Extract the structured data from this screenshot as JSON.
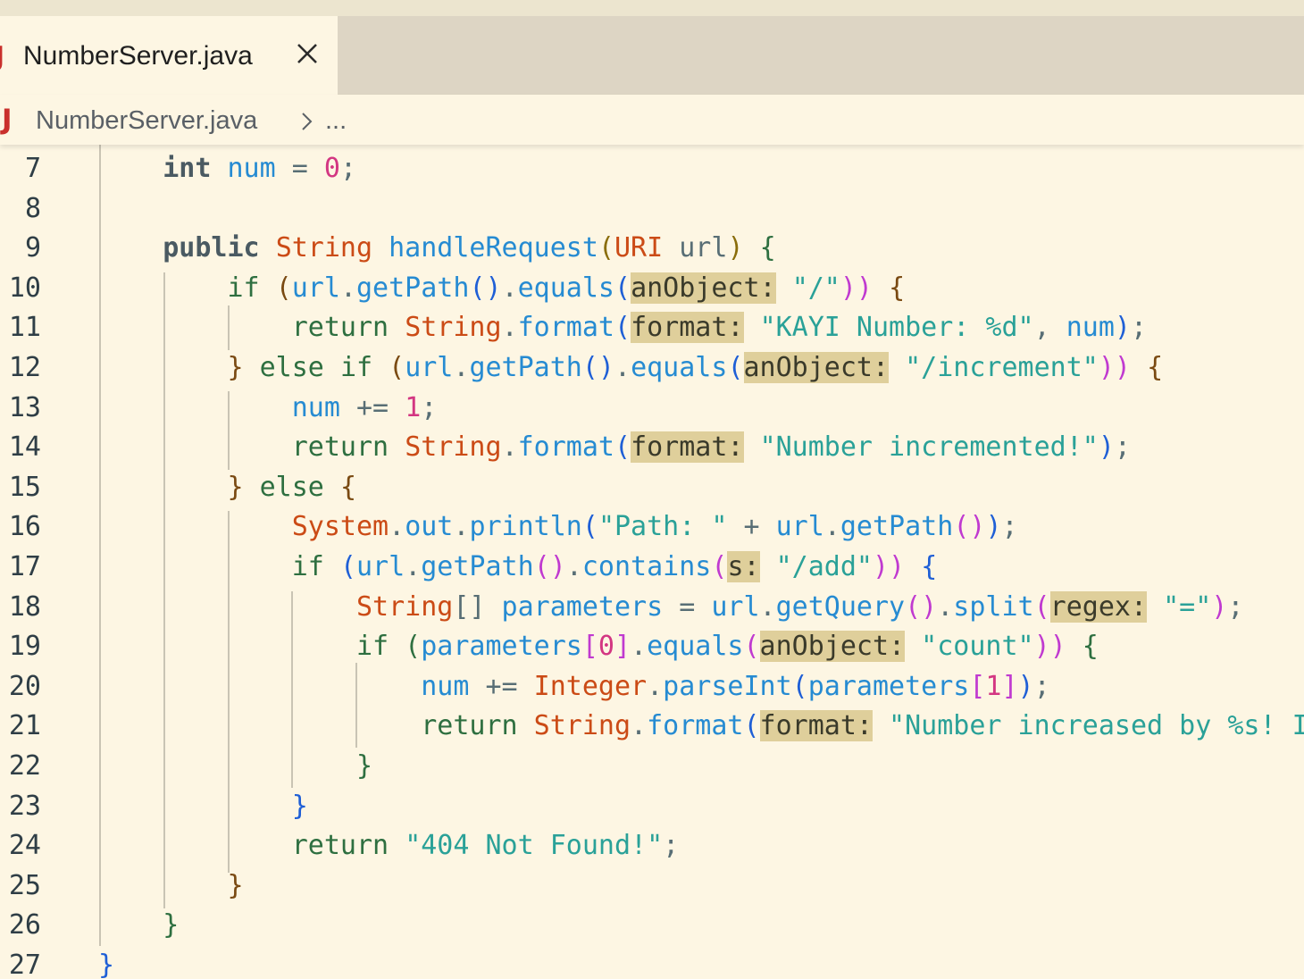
{
  "tab": {
    "icon_letter": "J",
    "label": "NumberServer.java",
    "close_glyph": "×"
  },
  "breadcrumb": {
    "icon_letter": "J",
    "file": "NumberServer.java",
    "rest": "..."
  },
  "theme": {
    "background": "#fdf6e3",
    "tabbar": "#ddd5c4",
    "keyword": "#2e6f40",
    "type": "#cb4b16",
    "identifier": "#268bd2",
    "string": "#2aa198",
    "number": "#d33682",
    "inlay_hint_bg": "#dfcf9b",
    "java_icon": "#c9302c"
  },
  "lines": [
    {
      "n": "7",
      "tokens": [
        [
          "    ",
          ""
        ],
        [
          "int",
          "t-kw-bold"
        ],
        [
          " ",
          ""
        ],
        [
          "num",
          "t-var"
        ],
        [
          " = ",
          "t-op"
        ],
        [
          "0",
          "t-num"
        ],
        [
          ";",
          "t-op"
        ]
      ]
    },
    {
      "n": "8",
      "tokens": []
    },
    {
      "n": "9",
      "tokens": [
        [
          "    ",
          ""
        ],
        [
          "public",
          "t-kw-bold"
        ],
        [
          " ",
          ""
        ],
        [
          "String",
          "t-type"
        ],
        [
          " ",
          ""
        ],
        [
          "handleRequest",
          "t-fn"
        ],
        [
          "(",
          "t-gold"
        ],
        [
          "URI",
          "t-type"
        ],
        [
          " url",
          "t-op"
        ],
        [
          ")",
          "t-gold"
        ],
        [
          " ",
          ""
        ],
        [
          "{",
          "t-kw"
        ]
      ]
    },
    {
      "n": "10",
      "tokens": [
        [
          "        ",
          ""
        ],
        [
          "if",
          "t-kw"
        ],
        [
          " ",
          ""
        ],
        [
          "(",
          "t-brn"
        ],
        [
          "url",
          "t-var"
        ],
        [
          ".",
          "t-op"
        ],
        [
          "getPath",
          "t-fn"
        ],
        [
          "()",
          "t-br3"
        ],
        [
          ".",
          "t-op"
        ],
        [
          "equals",
          "t-fn"
        ],
        [
          "(",
          "t-br3"
        ],
        [
          "anObject:",
          "t-hint"
        ],
        [
          " ",
          ""
        ],
        [
          "\"/\"",
          "t-str"
        ],
        [
          "))",
          "t-br2"
        ],
        [
          " ",
          ""
        ],
        [
          "{",
          "t-brn"
        ]
      ]
    },
    {
      "n": "11",
      "tokens": [
        [
          "            ",
          ""
        ],
        [
          "return",
          "t-kw"
        ],
        [
          " ",
          ""
        ],
        [
          "String",
          "t-type"
        ],
        [
          ".",
          "t-op"
        ],
        [
          "format",
          "t-fn"
        ],
        [
          "(",
          "t-br3"
        ],
        [
          "format:",
          "t-hint"
        ],
        [
          " ",
          ""
        ],
        [
          "\"KAYI Number: %d\"",
          "t-str"
        ],
        [
          ", ",
          "t-op"
        ],
        [
          "num",
          "t-var"
        ],
        [
          ")",
          "t-br3"
        ],
        [
          ";",
          "t-op"
        ]
      ]
    },
    {
      "n": "12",
      "tokens": [
        [
          "        ",
          ""
        ],
        [
          "}",
          "t-brn"
        ],
        [
          " ",
          ""
        ],
        [
          "else",
          "t-kw"
        ],
        [
          " ",
          ""
        ],
        [
          "if",
          "t-kw"
        ],
        [
          " ",
          ""
        ],
        [
          "(",
          "t-brn"
        ],
        [
          "url",
          "t-var"
        ],
        [
          ".",
          "t-op"
        ],
        [
          "getPath",
          "t-fn"
        ],
        [
          "()",
          "t-br3"
        ],
        [
          ".",
          "t-op"
        ],
        [
          "equals",
          "t-fn"
        ],
        [
          "(",
          "t-br3"
        ],
        [
          "anObject:",
          "t-hint"
        ],
        [
          " ",
          ""
        ],
        [
          "\"/increment\"",
          "t-str"
        ],
        [
          "))",
          "t-br2"
        ],
        [
          " ",
          ""
        ],
        [
          "{",
          "t-brn"
        ]
      ]
    },
    {
      "n": "13",
      "tokens": [
        [
          "            ",
          ""
        ],
        [
          "num",
          "t-var"
        ],
        [
          " += ",
          "t-op"
        ],
        [
          "1",
          "t-num"
        ],
        [
          ";",
          "t-op"
        ]
      ]
    },
    {
      "n": "14",
      "tokens": [
        [
          "            ",
          ""
        ],
        [
          "return",
          "t-kw"
        ],
        [
          " ",
          ""
        ],
        [
          "String",
          "t-type"
        ],
        [
          ".",
          "t-op"
        ],
        [
          "format",
          "t-fn"
        ],
        [
          "(",
          "t-br3"
        ],
        [
          "format:",
          "t-hint"
        ],
        [
          " ",
          ""
        ],
        [
          "\"Number incremented!\"",
          "t-str"
        ],
        [
          ")",
          "t-br3"
        ],
        [
          ";",
          "t-op"
        ]
      ]
    },
    {
      "n": "15",
      "tokens": [
        [
          "        ",
          ""
        ],
        [
          "}",
          "t-brn"
        ],
        [
          " ",
          ""
        ],
        [
          "else",
          "t-kw"
        ],
        [
          " ",
          ""
        ],
        [
          "{",
          "t-brn"
        ]
      ]
    },
    {
      "n": "16",
      "tokens": [
        [
          "            ",
          ""
        ],
        [
          "System",
          "t-type"
        ],
        [
          ".",
          "t-op"
        ],
        [
          "out",
          "t-var"
        ],
        [
          ".",
          "t-op"
        ],
        [
          "println",
          "t-fn"
        ],
        [
          "(",
          "t-br3"
        ],
        [
          "\"Path: \"",
          "t-str"
        ],
        [
          " + ",
          "t-op"
        ],
        [
          "url",
          "t-var"
        ],
        [
          ".",
          "t-op"
        ],
        [
          "getPath",
          "t-fn"
        ],
        [
          "()",
          "t-br2"
        ],
        [
          ")",
          "t-br3"
        ],
        [
          ";",
          "t-op"
        ]
      ]
    },
    {
      "n": "17",
      "tokens": [
        [
          "            ",
          ""
        ],
        [
          "if",
          "t-kw"
        ],
        [
          " ",
          ""
        ],
        [
          "(",
          "t-br3"
        ],
        [
          "url",
          "t-var"
        ],
        [
          ".",
          "t-op"
        ],
        [
          "getPath",
          "t-fn"
        ],
        [
          "()",
          "t-br2"
        ],
        [
          ".",
          "t-op"
        ],
        [
          "contains",
          "t-fn"
        ],
        [
          "(",
          "t-br2"
        ],
        [
          "s:",
          "t-hint"
        ],
        [
          " ",
          ""
        ],
        [
          "\"/add\"",
          "t-str"
        ],
        [
          "))",
          "t-br2"
        ],
        [
          " ",
          ""
        ],
        [
          "{",
          "t-br3"
        ]
      ]
    },
    {
      "n": "18",
      "tokens": [
        [
          "                ",
          ""
        ],
        [
          "String",
          "t-type"
        ],
        [
          "[]",
          "t-op"
        ],
        [
          " ",
          ""
        ],
        [
          "parameters",
          "t-var"
        ],
        [
          " = ",
          "t-op"
        ],
        [
          "url",
          "t-var"
        ],
        [
          ".",
          "t-op"
        ],
        [
          "getQuery",
          "t-fn"
        ],
        [
          "()",
          "t-br2"
        ],
        [
          ".",
          "t-op"
        ],
        [
          "split",
          "t-fn"
        ],
        [
          "(",
          "t-br2"
        ],
        [
          "regex:",
          "t-hint"
        ],
        [
          " ",
          ""
        ],
        [
          "\"=\"",
          "t-str"
        ],
        [
          ")",
          "t-br2"
        ],
        [
          ";",
          "t-op"
        ]
      ]
    },
    {
      "n": "19",
      "tokens": [
        [
          "                ",
          ""
        ],
        [
          "if",
          "t-kw"
        ],
        [
          " ",
          ""
        ],
        [
          "(",
          "t-kw"
        ],
        [
          "parameters",
          "t-var"
        ],
        [
          "[",
          "t-br2"
        ],
        [
          "0",
          "t-num"
        ],
        [
          "]",
          "t-br2"
        ],
        [
          ".",
          "t-op"
        ],
        [
          "equals",
          "t-fn"
        ],
        [
          "(",
          "t-br2"
        ],
        [
          "anObject:",
          "t-hint"
        ],
        [
          " ",
          ""
        ],
        [
          "\"count\"",
          "t-str"
        ],
        [
          "))",
          "t-br2"
        ],
        [
          " ",
          ""
        ],
        [
          "{",
          "t-kw"
        ]
      ]
    },
    {
      "n": "20",
      "tokens": [
        [
          "                    ",
          ""
        ],
        [
          "num",
          "t-var"
        ],
        [
          " += ",
          "t-op"
        ],
        [
          "Integer",
          "t-type"
        ],
        [
          ".",
          "t-op"
        ],
        [
          "parseInt",
          "t-fn"
        ],
        [
          "(",
          "t-br3"
        ],
        [
          "parameters",
          "t-var"
        ],
        [
          "[",
          "t-br2"
        ],
        [
          "1",
          "t-num"
        ],
        [
          "]",
          "t-br2"
        ],
        [
          ")",
          "t-br3"
        ],
        [
          ";",
          "t-op"
        ]
      ]
    },
    {
      "n": "21",
      "tokens": [
        [
          "                    ",
          ""
        ],
        [
          "return",
          "t-kw"
        ],
        [
          " ",
          ""
        ],
        [
          "String",
          "t-type"
        ],
        [
          ".",
          "t-op"
        ],
        [
          "format",
          "t-fn"
        ],
        [
          "(",
          "t-br3"
        ],
        [
          "format:",
          "t-hint"
        ],
        [
          " ",
          ""
        ],
        [
          "\"Number increased by %s! It",
          "t-str"
        ]
      ]
    },
    {
      "n": "22",
      "tokens": [
        [
          "                ",
          ""
        ],
        [
          "}",
          "t-kw"
        ]
      ]
    },
    {
      "n": "23",
      "tokens": [
        [
          "            ",
          ""
        ],
        [
          "}",
          "t-br3"
        ]
      ]
    },
    {
      "n": "24",
      "tokens": [
        [
          "            ",
          ""
        ],
        [
          "return",
          "t-kw"
        ],
        [
          " ",
          ""
        ],
        [
          "\"404 Not Found!\"",
          "t-str"
        ],
        [
          ";",
          "t-op"
        ]
      ]
    },
    {
      "n": "25",
      "tokens": [
        [
          "        ",
          ""
        ],
        [
          "}",
          "t-brn"
        ]
      ]
    },
    {
      "n": "26",
      "tokens": [
        [
          "    ",
          ""
        ],
        [
          "}",
          "t-kw"
        ]
      ]
    },
    {
      "n": "27",
      "tokens": [
        [
          "",
          ""
        ],
        [
          "}",
          "t-br3"
        ]
      ]
    }
  ]
}
